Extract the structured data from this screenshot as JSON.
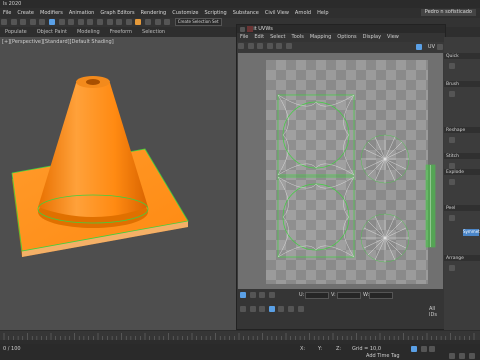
{
  "app": {
    "title": "ls 2020"
  },
  "menu": {
    "items": [
      "File",
      "Create",
      "Modifiers",
      "Animation",
      "Graph Editors",
      "Rendering",
      "Customize",
      "Scripting",
      "Substance",
      "Civil View",
      "Arnold",
      "Help"
    ],
    "signin": "Pedro n sofisticado"
  },
  "toolbar": {
    "selection_filter": "Create Selection Set"
  },
  "ribbon": {
    "tabs": [
      "Populate",
      "Object Paint",
      "Modeling",
      "Freeform",
      "Selection"
    ]
  },
  "viewport": {
    "label": "[+][Perspective][Standard][Default Shading]"
  },
  "uv_editor": {
    "title": "Edit UVWs",
    "menu": [
      "File",
      "Edit",
      "Select",
      "Tools",
      "Mapping",
      "Options",
      "Display",
      "View"
    ],
    "tools_label": "UV",
    "checker_label": "All IDs",
    "coords": {
      "u_label": "U:",
      "v_label": "V:",
      "w_label": "W:"
    }
  },
  "right_panel": {
    "labels": [
      "Quick",
      "Brush",
      "Reshape",
      "Stitch",
      "Explode",
      "Peel",
      "Arrange"
    ],
    "symmetry_value": "Symmetry"
  },
  "timeline": {
    "frame_label": "0 / 100",
    "add_time_tag": "Add Time Tag",
    "coords": {
      "x": "X:",
      "y": "Y:",
      "z": "Z:"
    },
    "grid_label": "Grid = 10,0"
  },
  "colors": {
    "cone_orange": "#ff8a12",
    "uv_edges": "#3fd13f",
    "accent_blue": "#4b86c8"
  }
}
